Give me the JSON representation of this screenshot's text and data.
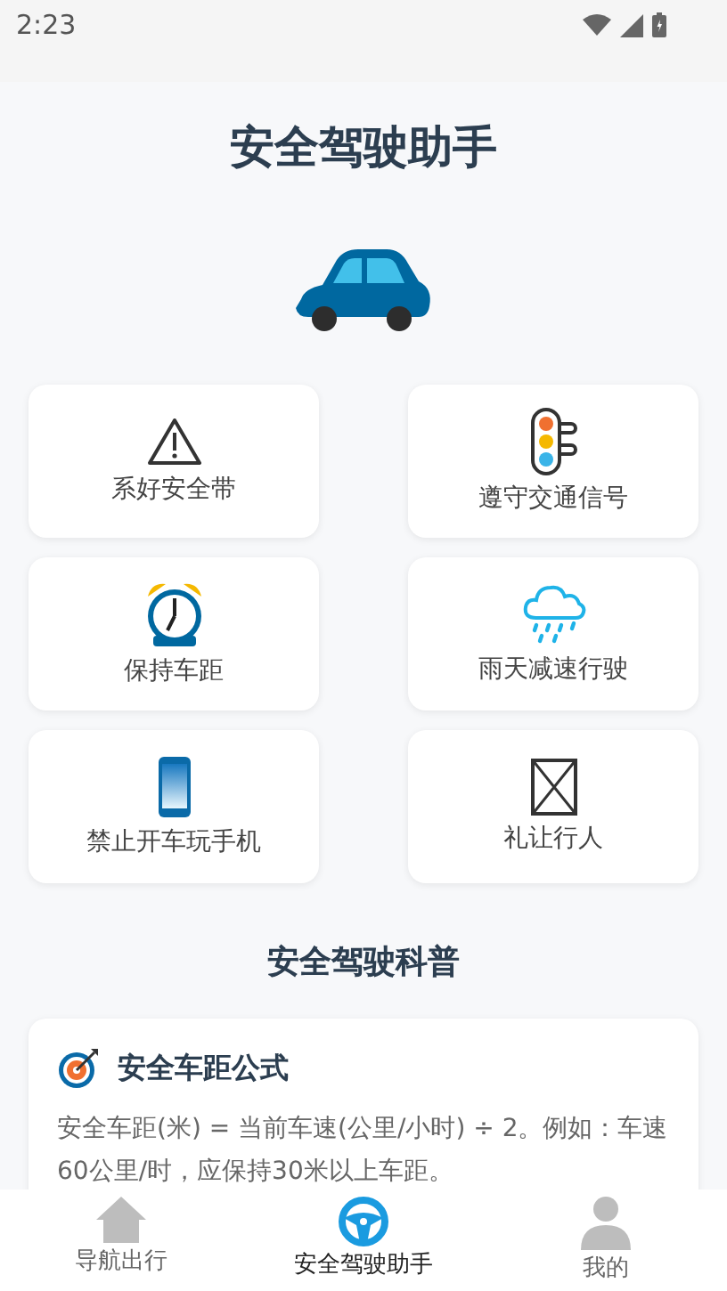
{
  "status_bar": {
    "time": "2:23"
  },
  "header": {
    "title": "安全驾驶助手"
  },
  "tips": [
    {
      "label": "系好安全带"
    },
    {
      "label": "遵守交通信号"
    },
    {
      "label": "保持车距"
    },
    {
      "label": "雨天减速行驶"
    },
    {
      "label": "禁止开车玩手机"
    },
    {
      "label": "礼让行人"
    }
  ],
  "science": {
    "title": "安全驾驶科普",
    "cards": [
      {
        "title": "安全车距公式",
        "text": "安全车距(米) = 当前车速(公里/小时) ÷ 2。例如：车速60公里/时，应保持30米以上车距。"
      }
    ]
  },
  "tab_bar": [
    {
      "label": "导航出行",
      "selected": false
    },
    {
      "label": "安全驾驶助手",
      "selected": true
    },
    {
      "label": "我的",
      "selected": false
    }
  ]
}
